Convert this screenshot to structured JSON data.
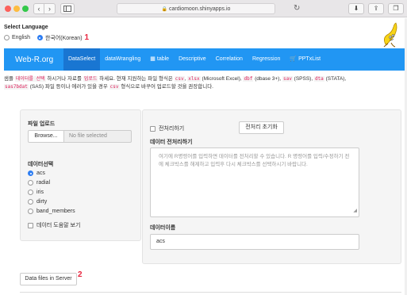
{
  "browser": {
    "url": "cardiomoon.shinyapps.io",
    "back_icon": "chevron-left-icon",
    "forward_icon": "chevron-right-icon",
    "sidebar_icon": "sidebar-icon",
    "reload_icon": "reload-icon",
    "download_icon": "download-icon",
    "share_icon": "share-icon",
    "tabs_icon": "tabs-icon",
    "back_glyph": "‹",
    "forward_glyph": "›",
    "reload_glyph": "↻",
    "download_glyph": "⬇",
    "share_glyph": "⇪",
    "tabs_glyph": "❐",
    "lock_glyph": "🔒"
  },
  "language": {
    "title": "Select Language",
    "options": [
      {
        "label": "English",
        "selected": false
      },
      {
        "label": "한국어(Korean)",
        "selected": true
      }
    ],
    "annotation": "1"
  },
  "navbar": {
    "brand": "Web-R.org",
    "items": [
      {
        "label": "DataSelect",
        "active": true,
        "icon": ""
      },
      {
        "label": "dataWrangling",
        "active": false,
        "icon": ""
      },
      {
        "label": "table",
        "active": false,
        "icon": "table-icon"
      },
      {
        "label": "Descriptive",
        "active": false,
        "icon": ""
      },
      {
        "label": "Correlation",
        "active": false,
        "icon": ""
      },
      {
        "label": "Regression",
        "active": false,
        "icon": ""
      },
      {
        "label": "PPTxList",
        "active": false,
        "icon": "cart-icon"
      }
    ],
    "color": "#2196f3",
    "active_color": "#1976d2"
  },
  "info": {
    "t1": "샘플 ",
    "h1": "데이터를 선택",
    "t2": " 하시거나 자료를 ",
    "h2": "업로드",
    "t3": " 하세요. 현재 지원하는 파일 형식은 ",
    "c1": "csv",
    "t4": ", ",
    "c2": "xlsx",
    "t5": " (Microsoft Excel), ",
    "c3": "dbf",
    "t6": " (dbase 3+), ",
    "c4": "sav",
    "t7": " (SPSS), ",
    "c5": "dta",
    "t8": " (STATA),",
    "c6": "sas7bdat",
    "t9": " (SAS) 파일 등이나 에러가 있을 경우 ",
    "c7": "csv",
    "t10": " 형식으로 바꾸어 업로드할 것을 권장합니다."
  },
  "left_panel": {
    "upload_label": "파일 업로드",
    "browse_label": "Browse...",
    "file_placeholder": "No file selected",
    "data_select_label": "데이터선택",
    "datasets": [
      {
        "label": "acs",
        "selected": true
      },
      {
        "label": "radial",
        "selected": false
      },
      {
        "label": "iris",
        "selected": false
      },
      {
        "label": "dirty",
        "selected": false
      },
      {
        "label": "band_members",
        "selected": false
      }
    ],
    "help_checkbox": "데이터 도움말 보기"
  },
  "right_panel": {
    "preprocess_checkbox": "전처리하기",
    "reset_button": "전처리 초기화",
    "preprocess_label": "데이터 전처리하기",
    "textarea_placeholder": "여기에 R명령어를 입력하면 데이터를 전처리할 수 있습니다. R 명령어를 입력/수정하기 전에 체크박스를 해제하고 입력후 다시 체크박스를 선택하시기 바랍니다.",
    "dataset_name_label": "데이터이름",
    "dataset_name_value": "acs"
  },
  "server_button": "Data files in Server",
  "server_annotation": "2"
}
